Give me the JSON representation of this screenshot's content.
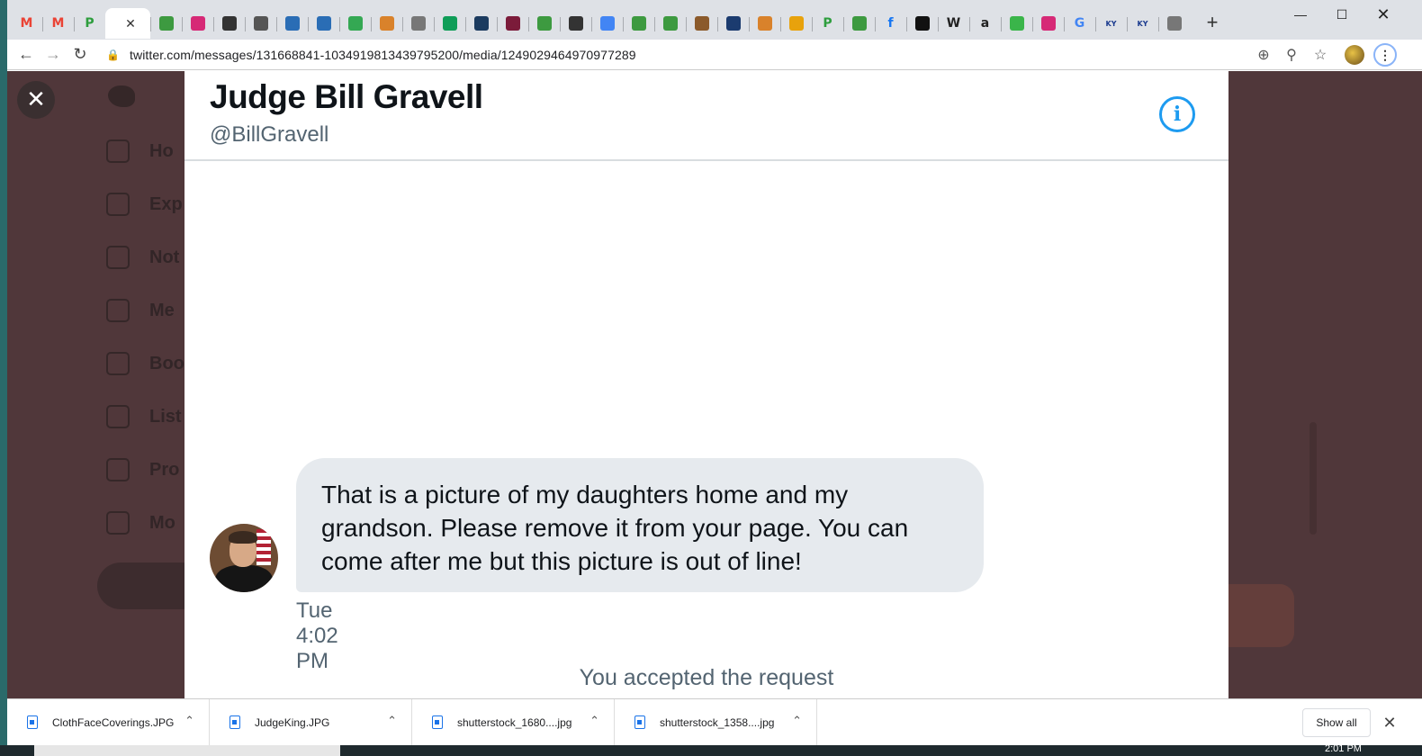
{
  "browser": {
    "tabs": [
      {
        "icon": "gmail-icon",
        "label": "M",
        "color": "#ea4335"
      },
      {
        "icon": "gmail-icon",
        "label": "M",
        "color": "#ea4335"
      },
      {
        "icon": "p-icon",
        "label": "P",
        "color": "#2e9e3e"
      },
      {
        "icon": "twitter-tab-icon",
        "label": "",
        "color": "#ffffff",
        "active": true
      },
      {
        "icon": "pin-icon",
        "label": "",
        "color": "#3d9a40"
      },
      {
        "icon": "instagram-icon",
        "label": "",
        "color": "#d62976"
      },
      {
        "icon": "news-icon",
        "label": "",
        "color": "#333333"
      },
      {
        "icon": "runner-icon",
        "label": "",
        "color": "#555555"
      },
      {
        "icon": "snowflake-icon",
        "label": "",
        "color": "#2a6db5"
      },
      {
        "icon": "snowflake-icon",
        "label": "",
        "color": "#2a6db5"
      },
      {
        "icon": "maps-icon",
        "label": "",
        "color": "#34a853"
      },
      {
        "icon": "star-icon",
        "label": "",
        "color": "#d9822b"
      },
      {
        "icon": "globe-icon",
        "label": "",
        "color": "#777777"
      },
      {
        "icon": "plus-green-icon",
        "label": "",
        "color": "#0f9d58"
      },
      {
        "icon": "airline-icon",
        "label": "",
        "color": "#1b3b5f"
      },
      {
        "icon": "hospital-icon",
        "label": "",
        "color": "#7b1b3a"
      },
      {
        "icon": "pin-icon",
        "label": "",
        "color": "#3d9a40"
      },
      {
        "icon": "truck-icon",
        "label": "",
        "color": "#333333"
      },
      {
        "icon": "docs-icon",
        "label": "",
        "color": "#4285f4"
      },
      {
        "icon": "pin-icon",
        "label": "",
        "color": "#3d9a40"
      },
      {
        "icon": "pin-icon",
        "label": "",
        "color": "#3d9a40"
      },
      {
        "icon": "eye-icon",
        "label": "",
        "color": "#8b5a2b"
      },
      {
        "icon": "police-star-icon",
        "label": "",
        "color": "#1b3b6f"
      },
      {
        "icon": "star-icon",
        "label": "",
        "color": "#d9822b"
      },
      {
        "icon": "badge-icon",
        "label": "",
        "color": "#e8a20c"
      },
      {
        "icon": "p-icon",
        "label": "P",
        "color": "#2e9e3e"
      },
      {
        "icon": "pin-icon",
        "label": "",
        "color": "#3d9a40"
      },
      {
        "icon": "facebook-icon",
        "label": "f",
        "color": "#1877f2"
      },
      {
        "icon": "swirl-icon",
        "label": "",
        "color": "#111111"
      },
      {
        "icon": "wikipedia-icon",
        "label": "W",
        "color": "#222222"
      },
      {
        "icon": "amazon-icon",
        "label": "a",
        "color": "#222222"
      },
      {
        "icon": "infinity-icon",
        "label": "",
        "color": "#3ab54a"
      },
      {
        "icon": "instagram-icon",
        "label": "",
        "color": "#d62976"
      },
      {
        "icon": "google-icon",
        "label": "G",
        "color": "#4285f4"
      },
      {
        "icon": "kyue-icon",
        "label": "KY",
        "color": "#1b3b8f"
      },
      {
        "icon": "kyue-icon",
        "label": "KY",
        "color": "#1b3b8f"
      },
      {
        "icon": "globe-icon",
        "label": "",
        "color": "#777777"
      }
    ],
    "active_tab_close": "✕",
    "new_tab": "+",
    "url": "twitter.com/messages/131668841-1034919813439795200/media/1249029464970977289"
  },
  "background_app": {
    "sidebar": [
      "Ho",
      "Exp",
      "Not",
      "Me",
      "Boo",
      "List",
      "Pro",
      "Mo"
    ]
  },
  "conversation": {
    "name": "Judge Bill Gravell",
    "handle": "@BillGravell",
    "message": "That is a picture of my daughters home and my grandson. Please remove it from your page. You can come after me but this picture is out of line!",
    "time": "Tue 4:02 PM",
    "status": "You accepted the request"
  },
  "downloads": {
    "items": [
      "ClothFaceCoverings.JPG",
      "JudgeKing.JPG",
      "shutterstock_1680....jpg",
      "shutterstock_1358....jpg"
    ],
    "show_all": "Show all"
  },
  "taskbar": {
    "clock": "2:01 PM"
  },
  "colors": {
    "accent": "#1d9bf0",
    "overlay": "#50373a",
    "bubble": "#e6eaee"
  }
}
